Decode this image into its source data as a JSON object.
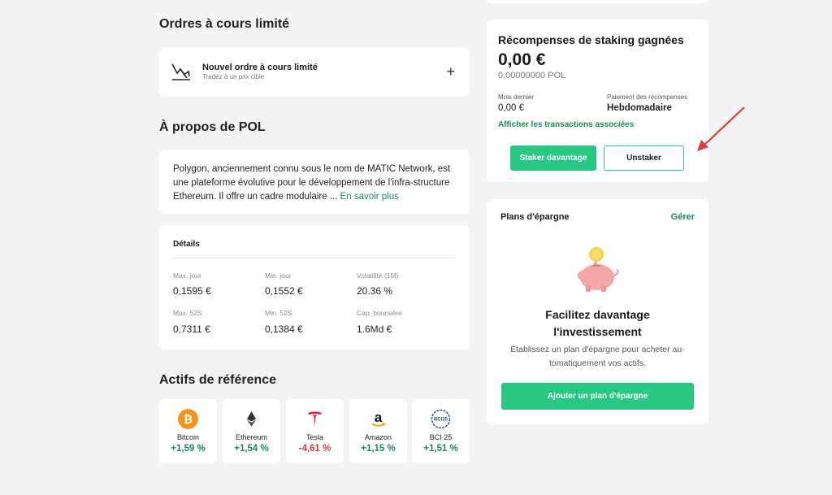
{
  "limit_orders": {
    "heading": "Ordres à cours limité",
    "new_order_title": "Nouvel ordre à cours limité",
    "new_order_subtitle": "Tradez à un prix cible",
    "plus": "+"
  },
  "about": {
    "heading": "À propos de POL",
    "text": "Polygon, anciennement connu sous le nom de MATIC Network, est une plateforme évolutive pour le développement de l'infra-structure Ethereum. Il offre un cadre modulaire ... ",
    "more_link": "En savoir plus"
  },
  "details": {
    "title": "Détails",
    "stats": [
      {
        "label": "Max. jour",
        "value": "0,1595 €"
      },
      {
        "label": "Min. jour",
        "value": "0,1552 €"
      },
      {
        "label": "Volatilité (1M)",
        "value": "20.36 %"
      },
      {
        "label": "Max. 52S",
        "value": "0,7311 €"
      },
      {
        "label": "Min. 52S",
        "value": "0,1384 €"
      },
      {
        "label": "Cap. boursière",
        "value": "1.6Md €"
      }
    ]
  },
  "reference_assets": {
    "heading": "Actifs de référence",
    "items": [
      {
        "name": "Bitcoin",
        "change": "+1,59 %",
        "icon": "bitcoin-icon",
        "color": "#f7931a"
      },
      {
        "name": "Ethereum",
        "change": "+1,54 %",
        "icon": "ethereum-icon",
        "color": "#222222"
      },
      {
        "name": "Tesla",
        "change": "-4,61 %",
        "icon": "tesla-icon",
        "color": "#e31937"
      },
      {
        "name": "Amazon",
        "change": "+1,15 %",
        "icon": "amazon-icon",
        "color": "#ff9900"
      },
      {
        "name": "BCI 25",
        "change": "+1,51 %",
        "icon": "bci25-icon",
        "color": "#1f4e8c",
        "badge": "BCI25"
      }
    ]
  },
  "staking": {
    "title": "Récompenses de staking gagnées",
    "amount": "0,00 €",
    "amount_pol": "0,00000000 POL",
    "last_month_label": "Mois dernier",
    "last_month_value": "0,00 €",
    "payout_label": "Paiement des récompenses",
    "payout_value": "Hebdomadaire",
    "transactions_link": "Afficher les transactions associées",
    "stake_more": "Staker davantage",
    "unstake": "Unstaker"
  },
  "savings": {
    "title": "Plans d'épargne",
    "manage": "Gérer",
    "headline_line1": "Facilitez davantage",
    "headline_line2": "l'investissement",
    "description": "Établissez un plan d'épargne pour acheter au-tomatiquement vos actifs.",
    "add_button": "Ajouter un plan d'épargne"
  },
  "colors": {
    "accent_green": "#29c882",
    "link_green": "#1b8a56",
    "negative_red": "#d93b3b",
    "arrow_red": "#e03a3a"
  }
}
